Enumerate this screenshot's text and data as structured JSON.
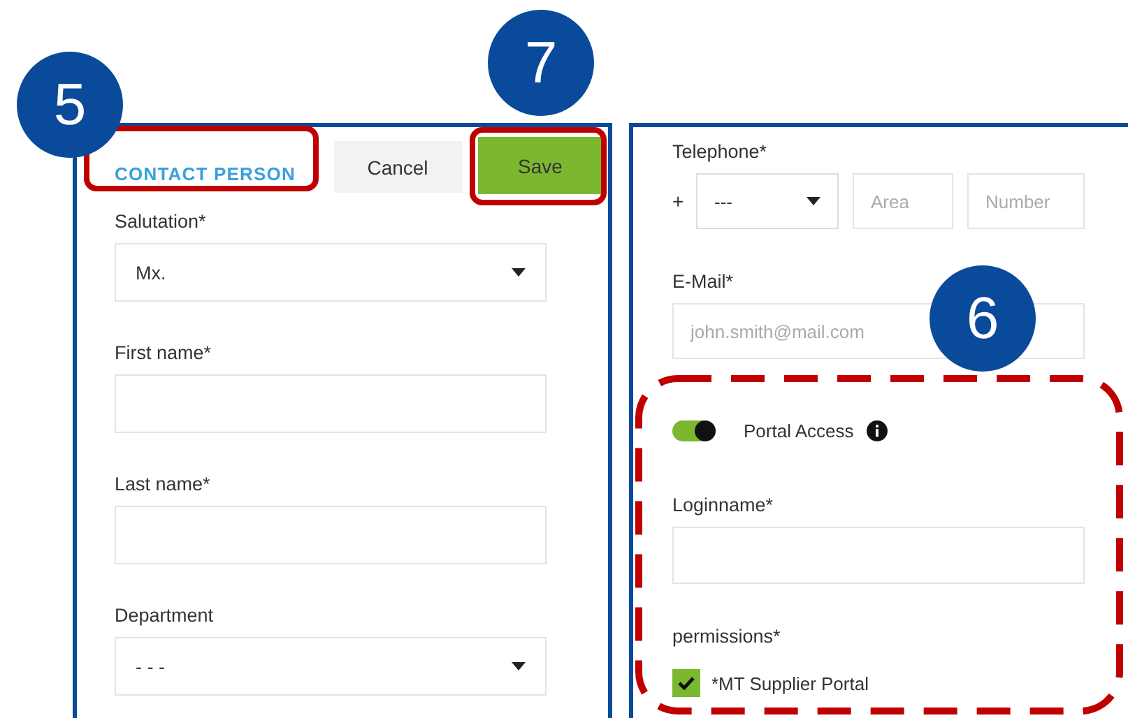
{
  "contact_panel": {
    "tab": {
      "label": "CONTACT PERSON",
      "selected": true
    },
    "buttons": [
      {
        "label": "Cancel",
        "kind": "secondary"
      },
      {
        "label": "Save",
        "kind": "primary"
      }
    ],
    "fields": [
      {
        "label": "Salutation*",
        "kind": "select",
        "value": "Mx."
      },
      {
        "label": "First name*",
        "kind": "text"
      },
      {
        "label": "Last name*",
        "kind": "text"
      },
      {
        "label": "Department",
        "kind": "select",
        "value": "- - -"
      }
    ]
  },
  "communication_panel": {
    "telephone": {
      "label": "Telephone*",
      "prefix": "+",
      "country": "---",
      "area_placeholder": "Area",
      "number_placeholder": "Number"
    },
    "email": {
      "label": "E-Mail*",
      "placeholder": "john.smith@mail.com"
    },
    "portal_access": {
      "label": "Portal Access",
      "on": true
    },
    "loginname": {
      "label": "Loginname*"
    },
    "permissions": {
      "label": "permissions*",
      "items": [
        {
          "label": "*MT Supplier Portal",
          "checked": true
        }
      ]
    }
  },
  "callouts": [
    {
      "label": "5"
    },
    {
      "label": "7"
    },
    {
      "label": "6"
    }
  ]
}
